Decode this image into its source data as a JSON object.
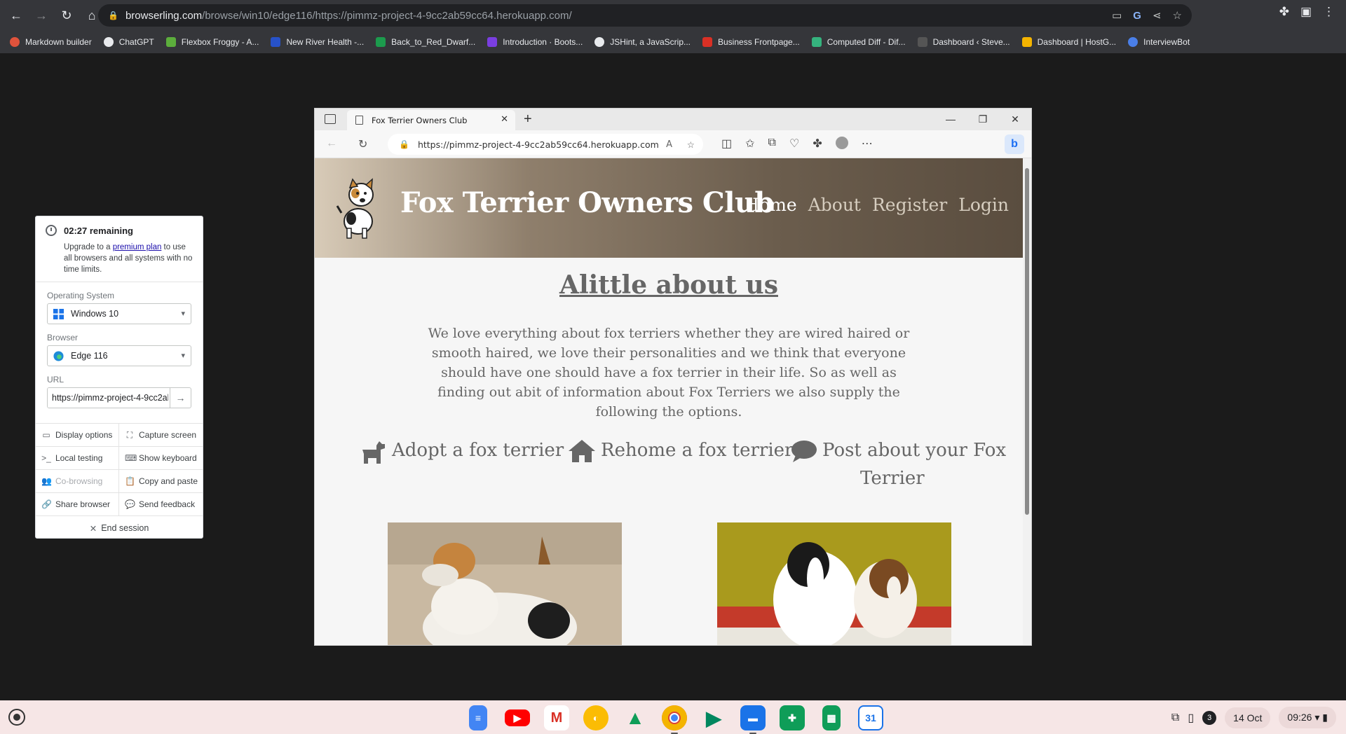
{
  "chrome": {
    "url_host": "browserling.com",
    "url_rest": "/browse/win10/edge116/https://pimmz-project-4-9cc2ab59cc64.herokuapp.com/",
    "bookmarks": [
      {
        "label": "Markdown builder",
        "color": "#e0533c"
      },
      {
        "label": "ChatGPT",
        "color": "#e8eaed"
      },
      {
        "label": "Flexbox Froggy - A...",
        "color": "#5cae3c"
      },
      {
        "label": "New River Health -...",
        "color": "#2752c9"
      },
      {
        "label": "Back_to_Red_Dwarf...",
        "color": "#1c9b4d"
      },
      {
        "label": "Introduction · Boots...",
        "color": "#7a3ee0"
      },
      {
        "label": "JSHint, a JavaScrip...",
        "color": "#e8eaed"
      },
      {
        "label": "Business Frontpage...",
        "color": "#d93025"
      },
      {
        "label": "Computed Diff - Dif...",
        "color": "#35b37e"
      },
      {
        "label": "Dashboard ‹ Steve...",
        "color": "#35363a"
      },
      {
        "label": "Dashboard | HostG...",
        "color": "#f4b400"
      },
      {
        "label": "InterviewBot",
        "color": "#4a7fe8"
      }
    ]
  },
  "panel": {
    "timer": "02:27 remaining",
    "upgrade_pre": "Upgrade to a ",
    "upgrade_link": "premium plan",
    "upgrade_post": " to use all browsers and all systems with no time limits.",
    "os_label": "Operating System",
    "os_value": "Windows 10",
    "browser_label": "Browser",
    "browser_value": "Edge 116",
    "url_label": "URL",
    "url_value": "https://pimmz-project-4-9cc2ab59cc64.herokuapp.com/",
    "buttons": {
      "display_options": "Display options",
      "capture_screen": "Capture screen",
      "local_testing": "Local testing",
      "show_keyboard": "Show keyboard",
      "co_browsing": "Co-browsing",
      "copy_paste": "Copy and paste",
      "share_browser": "Share browser",
      "send_feedback": "Send feedback"
    },
    "end_session": "End session"
  },
  "edge": {
    "tab_title": "Fox Terrier Owners Club",
    "url": "https://pimmz-project-4-9cc2ab59cc64.herokuapp.com"
  },
  "site": {
    "title": "Fox Terrier Owners Club",
    "nav": [
      "Home",
      "About",
      "Register",
      "Login"
    ],
    "about_heading": "Alittle about us",
    "about_text": "We love everything about fox terriers whether they are wired haired or smooth haired, we love their personalities and we think that everyone should have one should have a fox terrier in their life. So as well as finding out abit of information about Fox Terriers we also supply the following the options.",
    "options": {
      "adopt": "Adopt a fox terrier",
      "rehome": "Rehome a fox terrier",
      "post_line1": "Post about your Fox",
      "post_line2": "Terrier"
    }
  },
  "shelf": {
    "date": "14 Oct",
    "time": "09:26",
    "notif_count": "3"
  }
}
